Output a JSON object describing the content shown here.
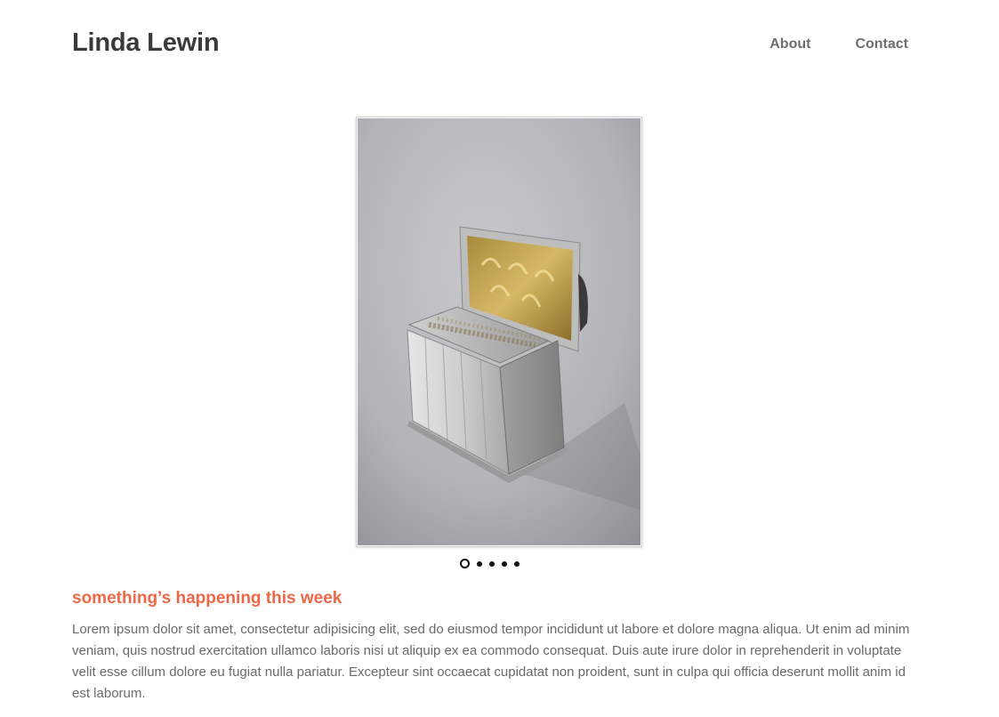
{
  "header": {
    "site_title": "Linda Lewin",
    "nav": [
      {
        "label": "About"
      },
      {
        "label": "Contact"
      }
    ]
  },
  "slideshow": {
    "image_icon": "silver-box-photo",
    "slide_count": 5,
    "active_index": 0
  },
  "news": {
    "heading": "something’s happening this week",
    "body": "Lorem ipsum dolor sit amet, consectetur adipisicing elit, sed do eiusmod tempor incididunt ut labore et dolore magna aliqua. Ut enim ad minim veniam, quis nostrud exercitation ullamco laboris nisi ut aliquip ex ea commodo consequat. Duis aute irure dolor in reprehenderit in voluptate velit esse cillum dolore eu fugiat nulla pariatur. Excepteur sint occaecat cupidatat non proident, sunt in culpa qui officia deserunt mollit anim id est laborum."
  },
  "colors": {
    "accent": "#f06748",
    "title": "#3a3a3a",
    "nav": "#6e6e6e",
    "body_text": "#6a6a6a"
  }
}
